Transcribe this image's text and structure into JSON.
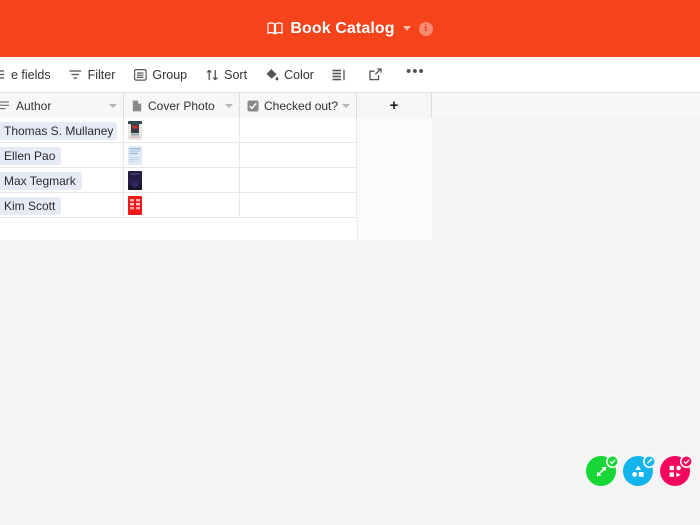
{
  "header": {
    "title": "Book Catalog",
    "book_icon": "book-icon",
    "caret_icon": "chevron-down-icon",
    "info_icon": "info-icon",
    "background_color": "#f5431c"
  },
  "toolbar": {
    "items": [
      {
        "label": "e fields",
        "icon": "hide-fields-icon",
        "name": "hide-fields-button"
      },
      {
        "label": "Filter",
        "icon": "filter-icon",
        "name": "filter-button"
      },
      {
        "label": "Group",
        "icon": "group-icon",
        "name": "group-button"
      },
      {
        "label": "Sort",
        "icon": "sort-icon",
        "name": "sort-button"
      },
      {
        "label": "Color",
        "icon": "color-drop-icon",
        "name": "color-button"
      },
      {
        "label": "",
        "icon": "row-height-icon",
        "name": "row-height-button"
      },
      {
        "label": "",
        "icon": "share-export-icon",
        "name": "share-button"
      },
      {
        "label": "•••",
        "icon": "more-icon",
        "name": "more-options-button"
      }
    ]
  },
  "grid": {
    "columns": [
      {
        "label": "Author",
        "icon": "text-lines-icon",
        "name": "column-author"
      },
      {
        "label": "Cover Photo",
        "icon": "attachment-icon",
        "name": "column-cover-photo"
      },
      {
        "label": "Checked out?",
        "icon": "checkbox-icon",
        "name": "column-checked-out"
      }
    ],
    "add_field_label": "+",
    "rows": [
      {
        "author": "Thomas S. Mullaney",
        "cover": "cover-dark-figure",
        "checked_out": ""
      },
      {
        "author": "Ellen Pao",
        "cover": "cover-light-blue",
        "checked_out": ""
      },
      {
        "author": "Max Tegmark",
        "cover": "cover-navy",
        "checked_out": ""
      },
      {
        "author": "Kim Scott",
        "cover": "cover-red",
        "checked_out": ""
      }
    ]
  },
  "badges": [
    {
      "name": "cursor-badge-green",
      "color": "#17d636",
      "glyph": "resize-arrow-icon",
      "check_color": "#17d636"
    },
    {
      "name": "cursor-badge-blue",
      "color": "#13b5ea",
      "glyph": "shapes-icon",
      "check_color": "#13b5ea"
    },
    {
      "name": "cursor-badge-pink",
      "color": "#f4075e",
      "glyph": "shapes-icon",
      "check_color": "#f4075e"
    }
  ]
}
